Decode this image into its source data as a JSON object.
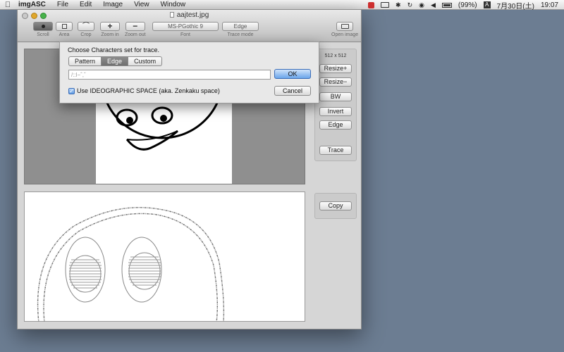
{
  "menubar": {
    "app_name": "imgASC",
    "menus": [
      "File",
      "Edit",
      "Image",
      "View",
      "Window"
    ],
    "battery": "(99%)",
    "date": "7月30日(土)",
    "time": "19:07"
  },
  "window": {
    "title": "aajtest.jpg",
    "toolbar": {
      "scroll": "Scroll",
      "area": "Area",
      "crop": "Crop",
      "zoom_in": "Zoom in",
      "zoom_out": "Zoom out",
      "font_value": "MS-PGothic 9",
      "font_label": "Font",
      "trace_mode_value": "Edge",
      "trace_mode_label": "Trace mode",
      "open_image": "Open image"
    },
    "side": {
      "size_label": "512 x 512",
      "buttons": [
        "Resize+",
        "Resize−",
        "BW",
        "Invert",
        "Edge",
        "Trace"
      ],
      "copy": "Copy"
    }
  },
  "dialog": {
    "prompt": "Choose Characters set for trace.",
    "tabs": [
      "Pattern",
      "Edge",
      "Custom"
    ],
    "active_tab": "Edge",
    "input_value": "/::l−ˆ,ˇ",
    "ok": "OK",
    "cancel": "Cancel",
    "checkbox_label": "Use IDEOGRAPHIC SPACE (aka. Zenkaku space)",
    "checkbox_checked": true
  }
}
